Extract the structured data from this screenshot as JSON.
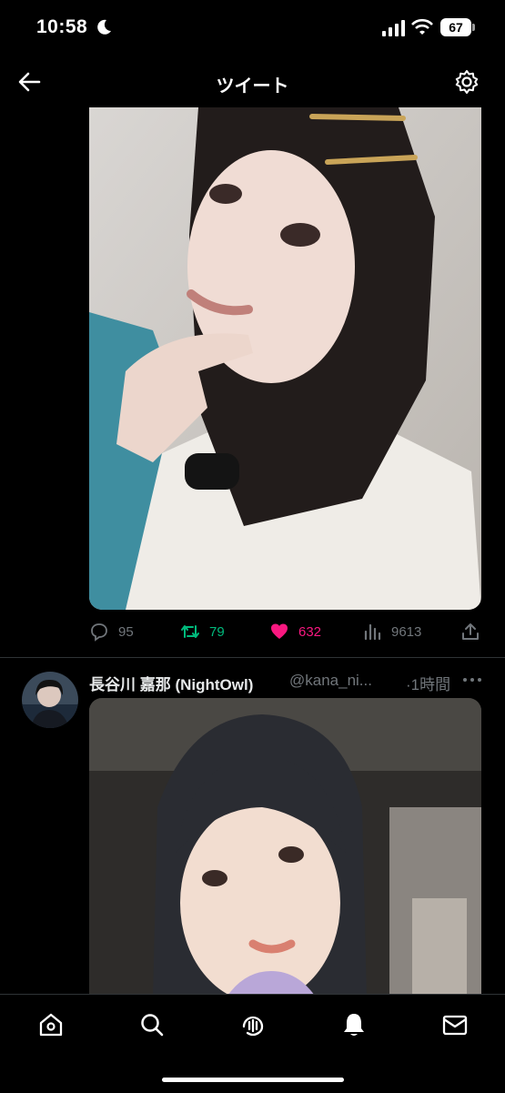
{
  "status_bar": {
    "time": "10:58",
    "battery": "67"
  },
  "header": {
    "title": "ツイート"
  },
  "tweet1": {
    "actions": {
      "replies": "95",
      "retweets": "79",
      "likes": "632",
      "views": "9613"
    }
  },
  "tweet2": {
    "name": "長谷川 嘉那 (NightOwl)",
    "handle": "@kana_ni...",
    "time": "·1時間"
  },
  "colors": {
    "retweet": "#00ba7c",
    "like": "#f91880",
    "muted": "#71767b",
    "background": "#000000"
  },
  "icons": {
    "tabs": [
      "home-icon",
      "search-icon",
      "spaces-icon",
      "notifications-icon",
      "messages-icon"
    ]
  }
}
